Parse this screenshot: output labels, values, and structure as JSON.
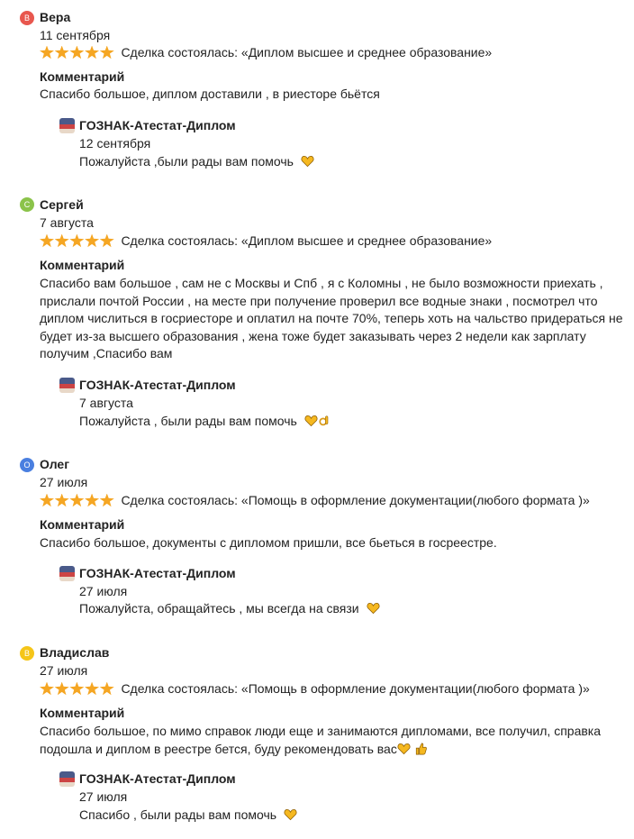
{
  "reviews": [
    {
      "avatar_letter": "В",
      "avatar_color": "#e8574e",
      "author": "Вера",
      "date": "11 сентября",
      "deal": "Сделка состоялась: «Диплом высшее и среднее образование»",
      "comment_label": "Комментарий",
      "comment": "Спасибо большое, диплом доставили , в риесторе бьётся",
      "reply_author": "ГОЗНАК-Атестат-Диплом",
      "reply_date": "12 сентября",
      "reply_text": "Пожалуйста ,были рады вам помочь",
      "reply_emojis": [
        "heart-hands-icon"
      ]
    },
    {
      "avatar_letter": "С",
      "avatar_color": "#8bc34a",
      "author": "Сергей",
      "date": "7 августа",
      "deal": "Сделка состоялась: «Диплом высшее и среднее образование»",
      "comment_label": "Комментарий",
      "comment": "Спасибо вам большое , сам не с Москвы и Спб , я с Коломны , не было возможности приехать , прислали почтой России , на месте при получение проверил все водные знаки , посмотрел что диплом числиться в госриесторе и оплатил на почте 70%, теперь хоть на чальство придераться не будет из-за высшего образования , жена тоже будет заказывать через 2 недели как зарплату получим ,Спасибо вам",
      "reply_author": "ГОЗНАК-Атестат-Диплом",
      "reply_date": "7 августа",
      "reply_text": "Пожалуйста , были рады вам помочь",
      "reply_emojis": [
        "heart-hands-icon",
        "ok-hand-icon"
      ]
    },
    {
      "avatar_letter": "О",
      "avatar_color": "#4a7fe0",
      "author": "Олег",
      "date": "27 июля",
      "deal": "Сделка состоялась: «Помощь в оформление документации(любого формата )»",
      "comment_label": "Комментарий",
      "comment": "Спасибо большое, документы с дипломом пришли, все бьеться в госреестре.",
      "reply_author": "ГОЗНАК-Атестат-Диплом",
      "reply_date": "27 июля",
      "reply_text": "Пожалуйста, обращайтесь , мы всегда на связи",
      "reply_emojis": [
        "heart-hands-icon"
      ]
    },
    {
      "avatar_letter": "В",
      "avatar_color": "#f5c518",
      "author": "Владислав",
      "date": "27 июля",
      "deal": "Сделка состоялась: «Помощь в оформление документации(любого формата )»",
      "comment_label": "Комментарий",
      "comment": "Спасибо большое, по мимо справок люди еще и занимаются дипломами, все получил, справка подошла и диплом в реестре бется, буду рекомендовать вас",
      "comment_emojis": [
        "heart-hands-icon",
        "thumbs-up-icon"
      ],
      "reply_author": "ГОЗНАК-Атестат-Диплом",
      "reply_date": "27 июля",
      "reply_text": "Спасибо , были рады вам помочь",
      "reply_emojis": [
        "heart-hands-icon"
      ]
    }
  ],
  "rating_stars": 5,
  "star_color": "#f5a623"
}
